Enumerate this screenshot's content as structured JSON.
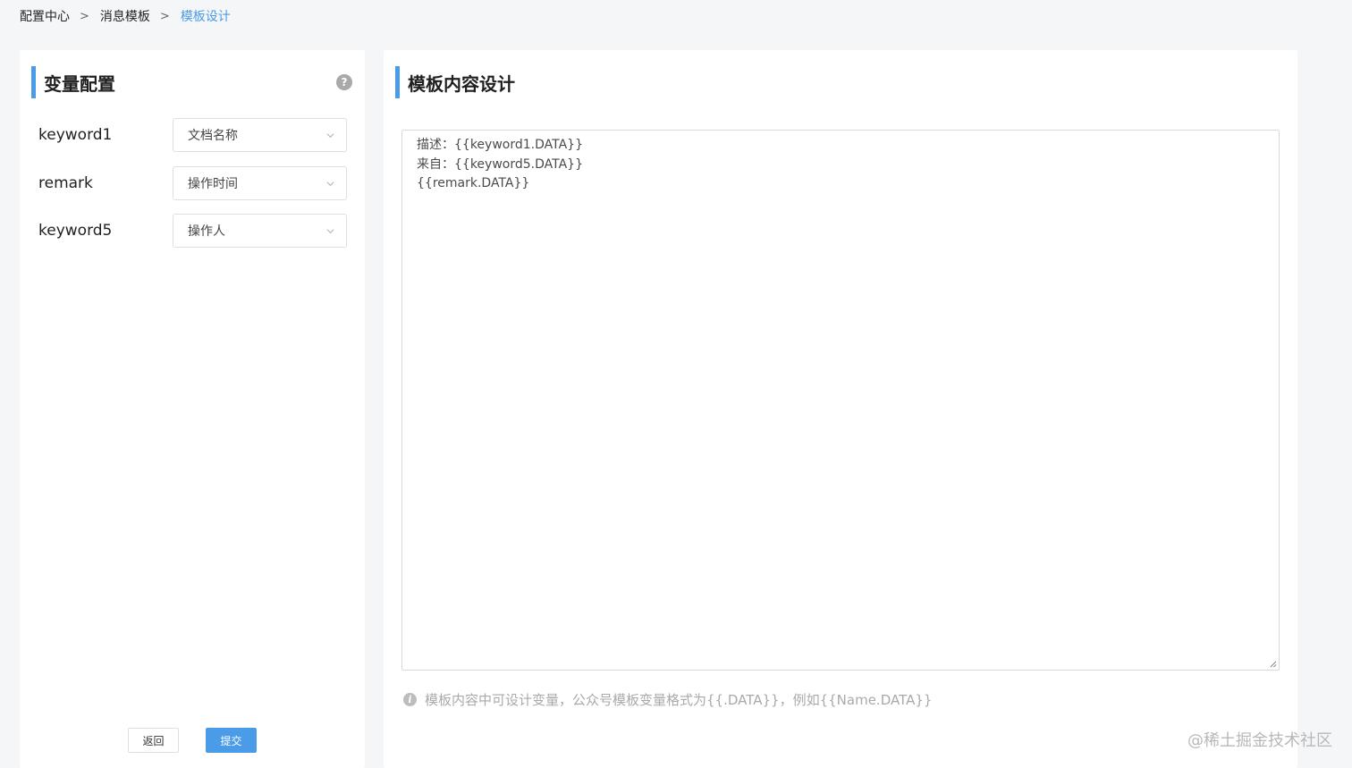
{
  "breadcrumb": {
    "items": [
      "配置中心",
      "消息模板",
      "模板设计"
    ],
    "separator": ">"
  },
  "left_panel": {
    "title": "变量配置",
    "help_icon": "question-circle-icon",
    "rows": [
      {
        "label": "keyword1",
        "value": "文档名称"
      },
      {
        "label": "remark",
        "value": "操作时间"
      },
      {
        "label": "keyword5",
        "value": "操作人"
      }
    ],
    "back_label": "返回",
    "submit_label": "提交"
  },
  "right_panel": {
    "title": "模板内容设计",
    "content_lines": [
      "描述：{{keyword1.DATA}}",
      "来自：{{keyword5.DATA}}",
      "{{remark.DATA}}"
    ],
    "hint_icon": "info-circle-icon",
    "hint": "模板内容中可设计变量，公众号模板变量格式为{{.DATA}}，例如{{Name.DATA}}"
  },
  "watermark": "@稀土掘金技术社区",
  "colors": {
    "accent": "#4a9be8",
    "background": "#f5f6f8"
  }
}
